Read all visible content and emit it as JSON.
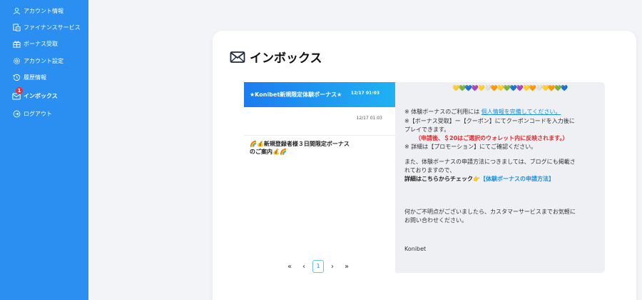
{
  "sidebar": {
    "items": [
      {
        "label": "アカウント情報"
      },
      {
        "label": "ファイナンスサービス"
      },
      {
        "label": "ボーナス受取"
      },
      {
        "label": "アカウント設定"
      },
      {
        "label": "履歴情報"
      },
      {
        "label": "インボックス",
        "badge": "1"
      },
      {
        "label": "ログアウト"
      }
    ]
  },
  "inbox": {
    "title": "インボックス"
  },
  "messages": [
    {
      "subject": "★Konibet新規限定体験ボーナス★",
      "date": "12/17 01:03"
    },
    {
      "subject": "🌈💰新規登録者様３日間限定ボーナスのご案内💰🌈",
      "date": "12/17 01:03"
    }
  ],
  "pagination": {
    "first": "«",
    "prev": "‹",
    "current": "1",
    "next": "›",
    "last": "»"
  },
  "detail": {
    "hearts": "💛💚💙💜💛🤍🧡💛💚💙💜💛🧡🤍💛🧡💚💙",
    "line1_prefix": "※ 体験ボーナスのご利用には ",
    "line1_link": "個人情報を完備してください。",
    "line2": "※【ボーナス受取】ー【クーポン】にてクーポンコードを入力後に",
    "line3": "プレイできます。",
    "line4": "（申請後、＄20はご選択のウォレット内に反映されます。）",
    "line5": "※ 詳細は【プロモーション】にてご確認ください。",
    "line6": "また、体験ボーナスの申請方法につきましては、ブログにも掲載さ",
    "line7": "れておりますので、",
    "line8_prefix": "詳細はこちらからチェック👉",
    "line8_link": "【体験ボーナスの申請方法】",
    "line9": "何かご不明点がございましたら、カスタマーサービスまでお気軽に",
    "line10": "お問い合わせください。",
    "signature": "Konibet"
  },
  "colors": {
    "sidebar": "#2b8ff2",
    "selected_gradient_start": "#1b7cf0",
    "selected_gradient_end": "#20b2f2",
    "link": "#1a8fe0",
    "alert": "#e02a2a",
    "badge": "#e8303a"
  },
  "icons": {
    "account": "user-icon",
    "finance": "finance-icon",
    "bonus": "gift-icon",
    "settings": "gear-icon",
    "history": "history-icon",
    "inbox": "inbox-icon",
    "logout": "logout-icon",
    "title": "envelope-icon"
  }
}
